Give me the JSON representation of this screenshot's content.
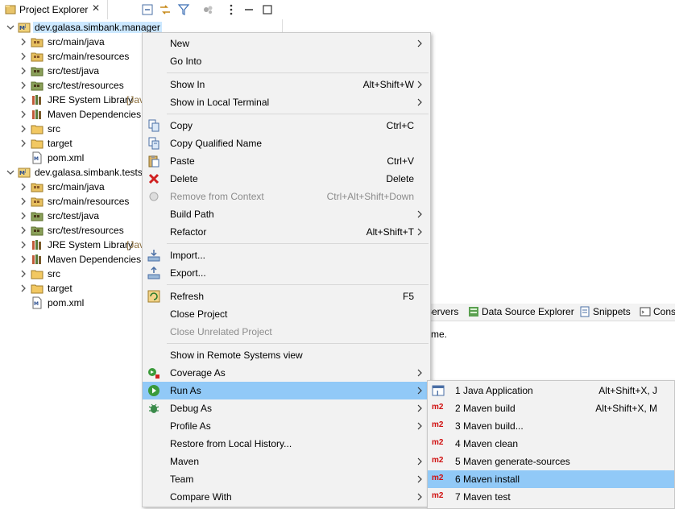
{
  "explorer": {
    "tab_title": "Project Explorer",
    "tab_close": "✕",
    "rows": [
      {
        "label": "dev.galasa.simbank.manager",
        "icon": "maven-project-icon",
        "twisty": "expanded"
      },
      {
        "label": "src/main/java",
        "icon": "source-folder-icon",
        "twisty": "collapsed"
      },
      {
        "label": "src/main/resources",
        "icon": "source-folder-icon",
        "twisty": "collapsed"
      },
      {
        "label": "src/test/java",
        "icon": "test-source-folder-icon",
        "twisty": "collapsed"
      },
      {
        "label": "src/test/resources",
        "icon": "test-source-folder-icon",
        "twisty": "collapsed"
      },
      {
        "label": "JRE System Library",
        "decoration": "[Jav",
        "icon": "library-icon",
        "twisty": "collapsed"
      },
      {
        "label": "Maven Dependencies",
        "icon": "library-icon",
        "twisty": "collapsed"
      },
      {
        "label": "src",
        "icon": "folder-icon",
        "twisty": "collapsed"
      },
      {
        "label": "target",
        "icon": "folder-icon",
        "twisty": "collapsed"
      },
      {
        "label": "pom.xml",
        "icon": "pom-file-icon",
        "twisty": "none"
      },
      {
        "label": "dev.galasa.simbank.tests",
        "icon": "maven-project-icon",
        "twisty": "expanded"
      },
      {
        "label": "src/main/java",
        "icon": "source-folder-icon",
        "twisty": "collapsed"
      },
      {
        "label": "src/main/resources",
        "icon": "source-folder-icon",
        "twisty": "collapsed"
      },
      {
        "label": "src/test/java",
        "icon": "test-source-folder-icon",
        "twisty": "collapsed"
      },
      {
        "label": "src/test/resources",
        "icon": "test-source-folder-icon",
        "twisty": "collapsed"
      },
      {
        "label": "JRE System Library",
        "decoration": "[Jav",
        "icon": "library-icon",
        "twisty": "collapsed"
      },
      {
        "label": "Maven Dependencies",
        "icon": "library-icon",
        "twisty": "collapsed"
      },
      {
        "label": "src",
        "icon": "folder-icon",
        "twisty": "collapsed"
      },
      {
        "label": "target",
        "icon": "folder-icon",
        "twisty": "collapsed"
      },
      {
        "label": "pom.xml",
        "icon": "pom-file-icon",
        "twisty": "none"
      }
    ]
  },
  "bottom_panel": {
    "tabs": [
      "Servers",
      "Data Source Explorer",
      "Snippets",
      "Cons"
    ],
    "message": "me."
  },
  "context_menu": {
    "items": [
      {
        "label": "New",
        "shortcut": "",
        "submenu": true
      },
      {
        "label": "Go Into",
        "shortcut": "",
        "submenu": false
      },
      {
        "separator": true
      },
      {
        "label": "Show In",
        "shortcut": "Alt+Shift+W",
        "submenu": true
      },
      {
        "label": "Show in Local Terminal",
        "shortcut": "",
        "submenu": true
      },
      {
        "separator": true
      },
      {
        "label": "Copy",
        "shortcut": "Ctrl+C",
        "icon": "copy-icon"
      },
      {
        "label": "Copy Qualified Name",
        "shortcut": "",
        "icon": "copy-qualified-icon"
      },
      {
        "label": "Paste",
        "shortcut": "Ctrl+V",
        "icon": "paste-icon"
      },
      {
        "label": "Delete",
        "shortcut": "Delete",
        "icon": "delete-icon"
      },
      {
        "label": "Remove from Context",
        "shortcut": "Ctrl+Alt+Shift+Down",
        "icon": "remove-context-icon",
        "disabled": true
      },
      {
        "label": "Build Path",
        "shortcut": "",
        "submenu": true
      },
      {
        "label": "Refactor",
        "shortcut": "Alt+Shift+T",
        "submenu": true
      },
      {
        "separator": true
      },
      {
        "label": "Import...",
        "shortcut": "",
        "icon": "import-icon"
      },
      {
        "label": "Export...",
        "shortcut": "",
        "icon": "export-icon"
      },
      {
        "separator": true
      },
      {
        "label": "Refresh",
        "shortcut": "F5",
        "icon": "refresh-icon"
      },
      {
        "label": "Close Project",
        "shortcut": ""
      },
      {
        "label": "Close Unrelated Project",
        "shortcut": "",
        "disabled": true
      },
      {
        "separator": true
      },
      {
        "label": "Show in Remote Systems view",
        "shortcut": ""
      },
      {
        "label": "Coverage As",
        "shortcut": "",
        "submenu": true,
        "icon": "coverage-icon"
      },
      {
        "label": "Run As",
        "shortcut": "",
        "submenu": true,
        "icon": "run-icon",
        "highlighted": true
      },
      {
        "label": "Debug As",
        "shortcut": "",
        "submenu": true,
        "icon": "debug-icon"
      },
      {
        "label": "Profile As",
        "shortcut": "",
        "submenu": true
      },
      {
        "label": "Restore from Local History...",
        "shortcut": ""
      },
      {
        "label": "Maven",
        "shortcut": "",
        "submenu": true
      },
      {
        "label": "Team",
        "shortcut": "",
        "submenu": true
      },
      {
        "label": "Compare With",
        "shortcut": "",
        "submenu": true
      }
    ]
  },
  "run_as_submenu": {
    "items": [
      {
        "icon_text": "J",
        "icon": "java-application-icon",
        "label": "1 Java Application",
        "shortcut": "Alt+Shift+X, J"
      },
      {
        "icon_text": "m2",
        "icon": "maven-m2-icon",
        "label": "2 Maven build",
        "shortcut": "Alt+Shift+X, M"
      },
      {
        "icon_text": "m2",
        "icon": "maven-m2-icon",
        "label": "3 Maven build...",
        "shortcut": ""
      },
      {
        "icon_text": "m2",
        "icon": "maven-m2-icon",
        "label": "4 Maven clean",
        "shortcut": ""
      },
      {
        "icon_text": "m2",
        "icon": "maven-m2-icon",
        "label": "5 Maven generate-sources",
        "shortcut": ""
      },
      {
        "icon_text": "m2",
        "icon": "maven-m2-icon",
        "label": "6 Maven install",
        "shortcut": "",
        "highlighted": true
      },
      {
        "icon_text": "m2",
        "icon": "maven-m2-icon",
        "label": "7 Maven test",
        "shortcut": ""
      }
    ]
  },
  "colors": {
    "menu_bg": "#f2f2f2",
    "menu_highlight": "#91c9f7",
    "selection": "#cce8ff",
    "m2_red": "#d01010"
  }
}
